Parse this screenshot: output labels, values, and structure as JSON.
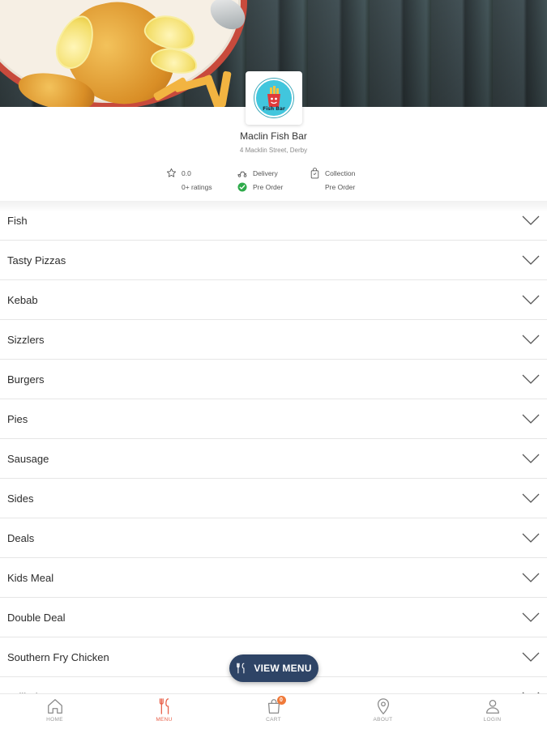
{
  "store": {
    "name": "Maclin Fish Bar",
    "address": "4 Macklin Street, Derby",
    "logo_text": "Fish Bar"
  },
  "meta": {
    "rating_value": "0.0",
    "ratings_count": "0+ ratings",
    "delivery_label": "Delivery",
    "delivery_mode": "Pre Order",
    "collection_label": "Collection",
    "collection_mode": "Pre Order"
  },
  "categories": [
    "Fish",
    "Tasty Pizzas",
    "Kebab",
    "Sizzlers",
    "Burgers",
    "Pies",
    "Sausage",
    "Sides",
    "Deals",
    "Kids Meal",
    "Double Deal",
    "Southern Fry Chicken",
    "Grilled"
  ],
  "floating_button": {
    "label": "VIEW MENU"
  },
  "bottom_nav": [
    {
      "label": "HOME",
      "icon": "home-icon",
      "active": false
    },
    {
      "label": "MENU",
      "icon": "cutlery-icon",
      "active": true
    },
    {
      "label": "CART",
      "icon": "bag-icon",
      "active": false,
      "badge": "0"
    },
    {
      "label": "ABOUT",
      "icon": "location-pin-icon",
      "active": false
    },
    {
      "label": "LOGIN",
      "icon": "user-icon",
      "active": false
    }
  ],
  "colors": {
    "accent": "#e8614a",
    "button_bg": "#2e4466",
    "check_green": "#2eaa4a",
    "badge": "#f07a3a"
  }
}
